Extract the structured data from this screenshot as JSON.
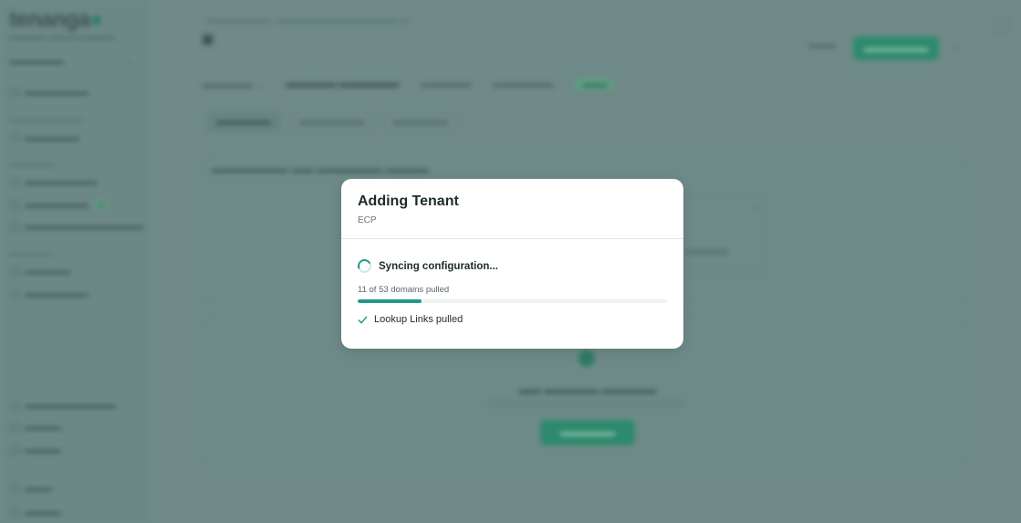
{
  "modal": {
    "title": "Adding Tenant",
    "subtitle": "ECP",
    "sync_status": "Syncing configuration...",
    "progress_text": "11 of 53 domains pulled",
    "progress_fraction": 0.2075,
    "completed_items": [
      "Lookup Links pulled"
    ],
    "accent_color": "#1e9a86"
  }
}
